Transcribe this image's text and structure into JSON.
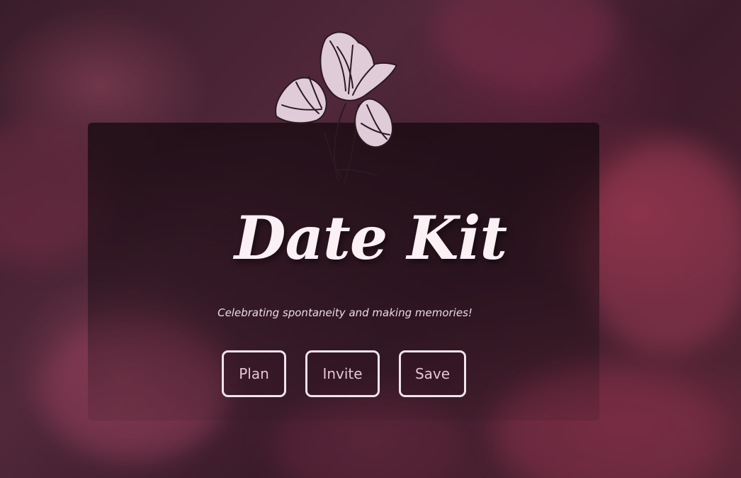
{
  "hero": {
    "title": "Date Kit",
    "tagline": "Celebrating spontaneity and making memories!"
  },
  "buttons": {
    "plan": "Plan",
    "invite": "Invite",
    "save": "Save"
  },
  "logo": {
    "icon": "flower-illustration",
    "petal_color": "#e0ccd8",
    "outline_color": "#2a1a22"
  },
  "colors": {
    "background": "#3a1d2a",
    "accent": "#b8475f",
    "title": "#fbf0f4",
    "button_text": "#e3c6d2"
  }
}
